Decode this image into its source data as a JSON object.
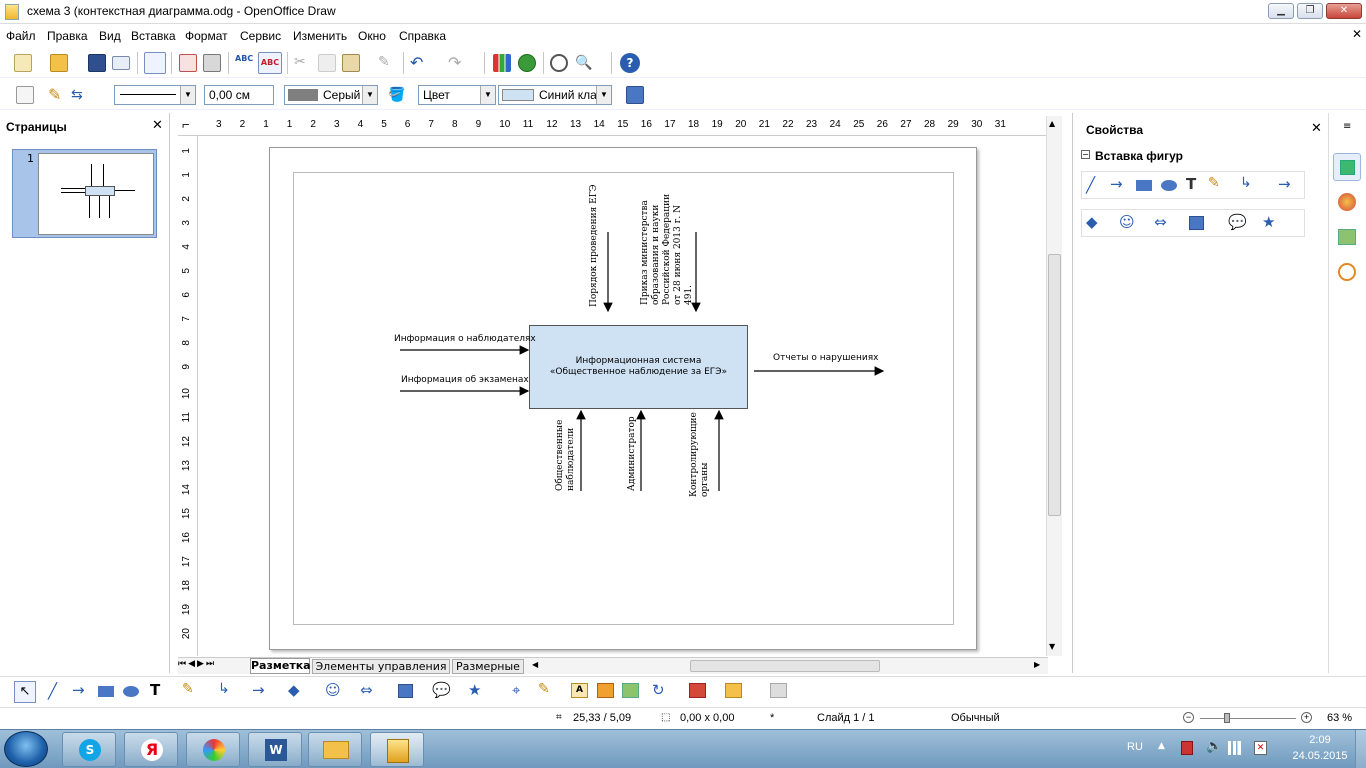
{
  "window": {
    "title": "схема 3 (контекстная диаграмма.odg - OpenOffice Draw"
  },
  "menu": [
    "Файл",
    "Правка",
    "Вид",
    "Вставка",
    "Формат",
    "Сервис",
    "Изменить",
    "Окно",
    "Справка"
  ],
  "line_toolbar": {
    "line_width": "0,00 см",
    "line_color": "Серый",
    "area_style": "Цвет",
    "area_color": "Синий кла"
  },
  "pages_panel": {
    "title": "Страницы",
    "page_number": "1"
  },
  "ruler": {
    "h_ticks": [
      "3",
      "2",
      "1",
      "1",
      "2",
      "3",
      "4",
      "5",
      "6",
      "7",
      "8",
      "9",
      "10",
      "11",
      "12",
      "13",
      "14",
      "15",
      "16",
      "17",
      "18",
      "19",
      "20",
      "21",
      "22",
      "23",
      "24",
      "25",
      "26",
      "27",
      "28",
      "29",
      "30",
      "31"
    ],
    "v_ticks": [
      "1",
      "1",
      "2",
      "3",
      "4",
      "5",
      "6",
      "7",
      "8",
      "9",
      "10",
      "11",
      "12",
      "13",
      "14",
      "15",
      "16",
      "17",
      "18",
      "19",
      "20"
    ]
  },
  "diagram": {
    "box": "Информационная система «Общественное наблюдение за ЕГЭ»",
    "input1": "Информация о наблюдателях",
    "input2": "Информация об экзаменах",
    "output": "Отчеты о нарушениях",
    "control1": "Порядок проведения ЕГЭ",
    "control2": "Приказ министерства образования и науки Российской Федерации от 28 июня 2013 г. N 491.",
    "mech1": "Общественные наблюдатели",
    "mech2": "Администратор",
    "mech3": "Контролирующие органы"
  },
  "tabs": [
    "Разметка",
    "Элементы управления",
    "Размерные"
  ],
  "properties_panel": {
    "title": "Свойства",
    "section": "Вставка фигур"
  },
  "status": {
    "position": "25,33 / 5,09",
    "size": "0,00 x 0,00",
    "modified": "*",
    "slide": "Слайд 1 / 1",
    "layout": "Обычный",
    "zoom": "63 %"
  },
  "taskbar": {
    "lang": "RU",
    "time": "2:09",
    "date": "24.05.2015"
  },
  "colors": {
    "box_fill": "#cfe2f3",
    "accent": "#4a77c4",
    "selected_tab": "#ffffff"
  }
}
